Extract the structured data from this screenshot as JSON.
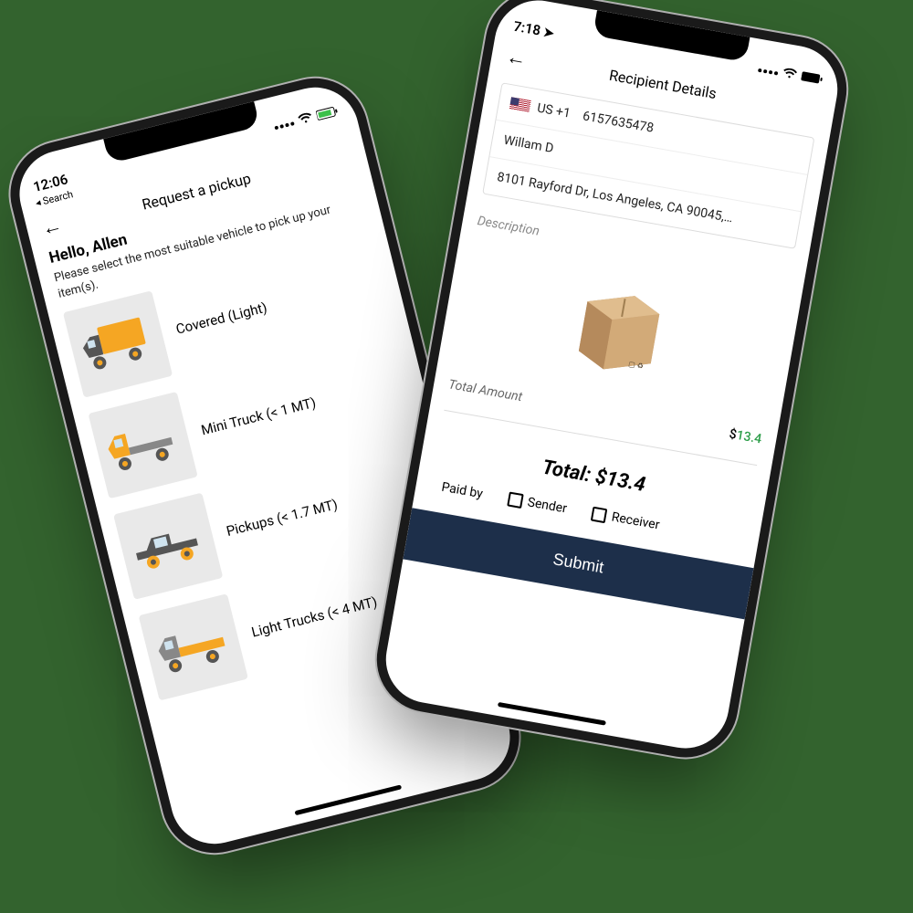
{
  "left": {
    "status": {
      "time": "12:06",
      "breadcrumb": "◂ Search"
    },
    "header_title": "Request a pickup",
    "hello": "Hello, Allen",
    "subtext": "Please select the most suitable vehicle to pick up your item(s).",
    "vehicles": [
      {
        "label": "Covered (Light)"
      },
      {
        "label": "Mini Truck (< 1 MT)"
      },
      {
        "label": "Pickups (< 1.7 MT)"
      },
      {
        "label": "Light Trucks (< 4 MT)"
      }
    ]
  },
  "right": {
    "status": {
      "time": "7:18"
    },
    "header_title": "Recipient Details",
    "phone_prefix": "US +1",
    "phone_number": "6157635478",
    "name": "Willam D",
    "address": "8101 Rayford Dr, Los Angeles, CA 90045,…",
    "desc_label": "Description",
    "amount_label": "Total Amount",
    "amount_value": "13.4",
    "total_label": "Total: $13.4",
    "paidby_label": "Paid by",
    "option_sender": "Sender",
    "option_receiver": "Receiver",
    "submit_label": "Submit"
  }
}
